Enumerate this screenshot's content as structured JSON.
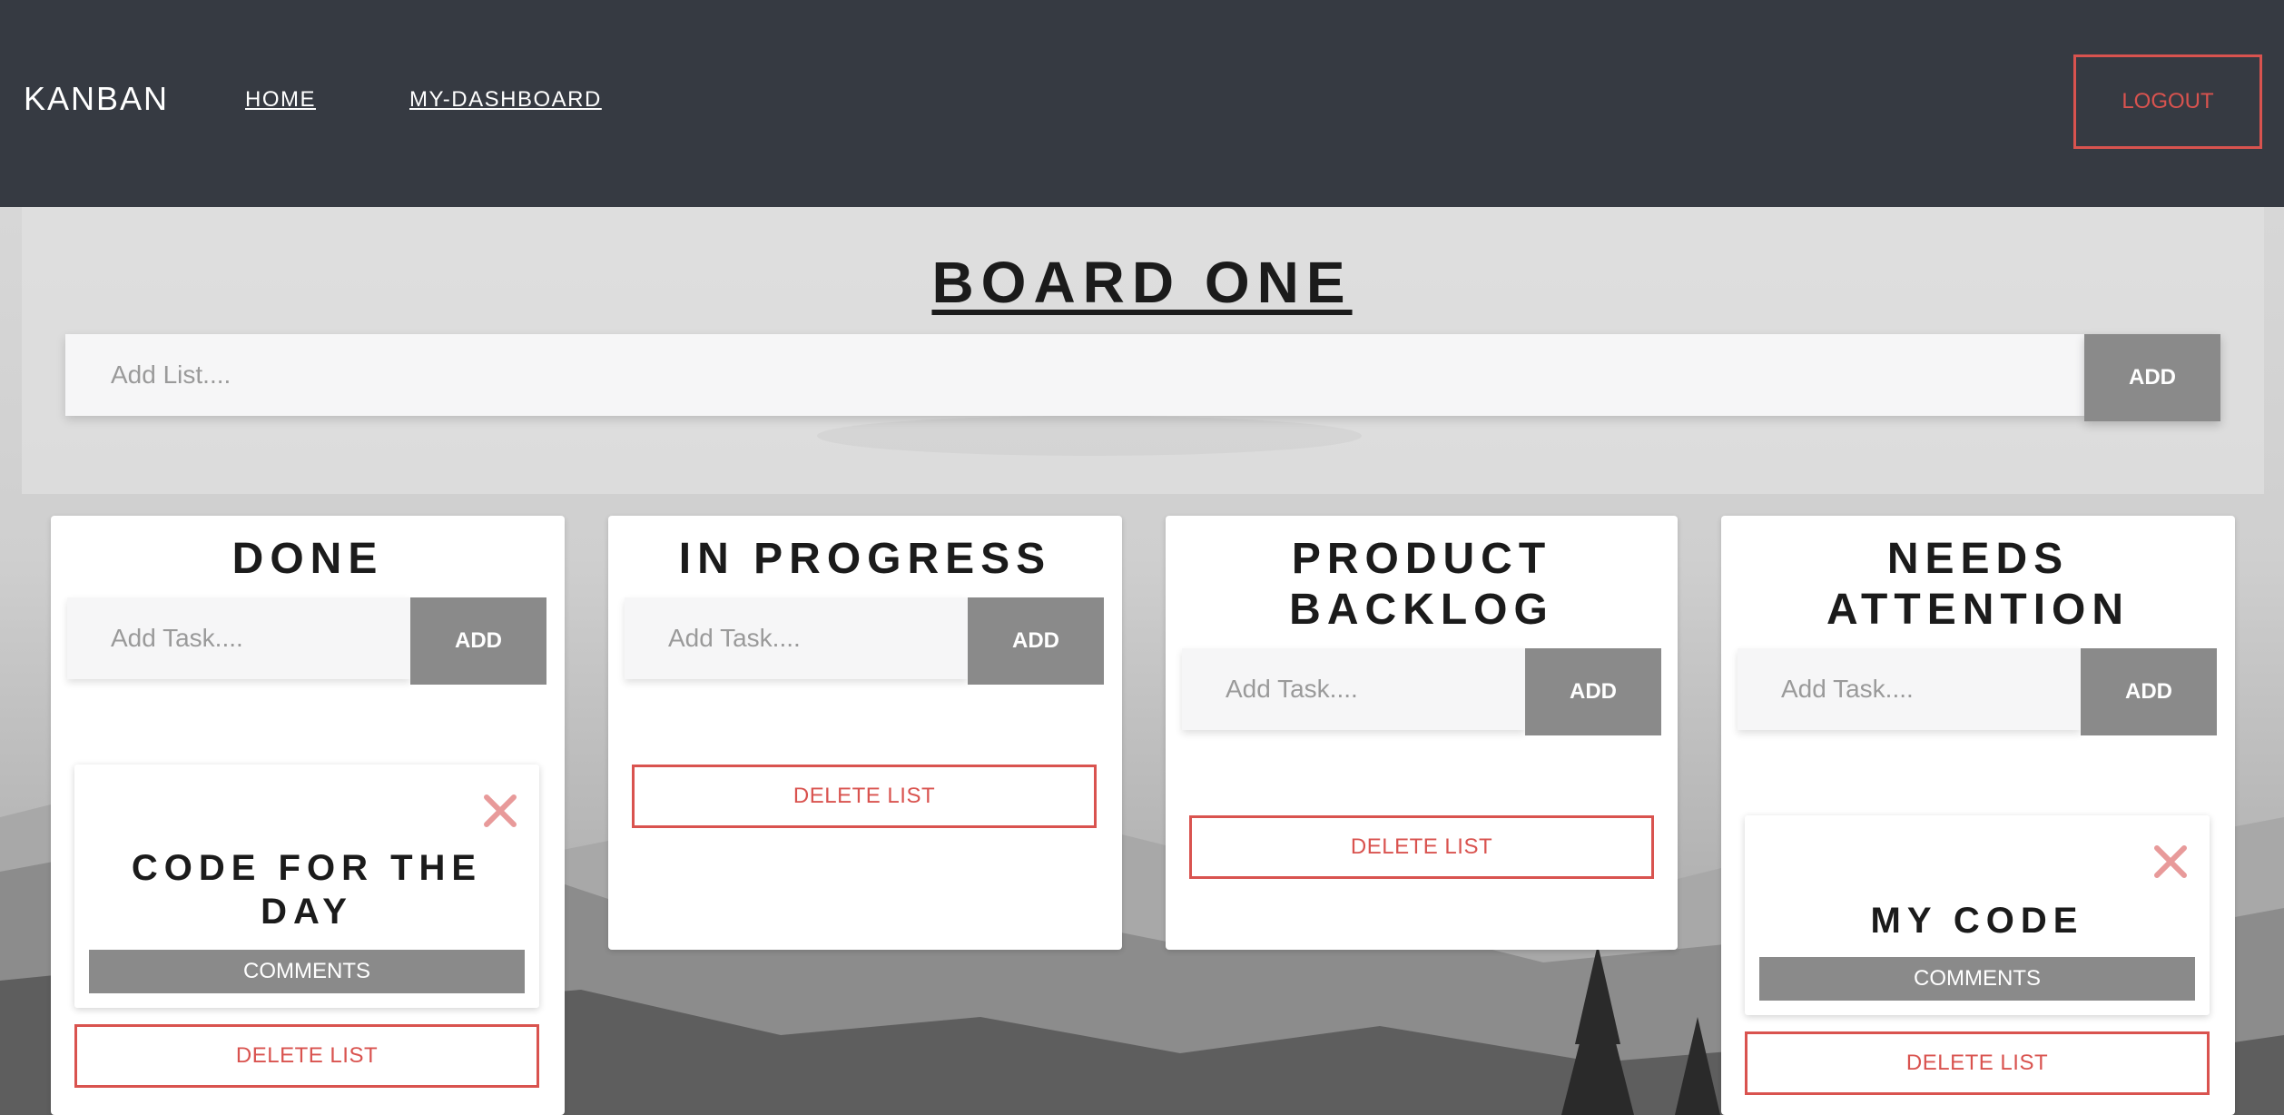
{
  "navbar": {
    "brand": "KANBAN",
    "links": [
      {
        "label": "HOME"
      },
      {
        "label": "MY-DASHBOARD"
      }
    ],
    "logout_label": "LOGOUT"
  },
  "board": {
    "title": "BOARD ONE",
    "add_list_placeholder": "Add List....",
    "add_list_button": "ADD"
  },
  "lists": [
    {
      "title_lines": [
        "DONE"
      ],
      "task_placeholder": "Add Task....",
      "add_label": "ADD",
      "tasks": [
        {
          "title_lines": [
            "CODE FOR THE",
            "DAY"
          ],
          "comments_label": "COMMENTS"
        }
      ],
      "delete_label": "DELETE LIST"
    },
    {
      "title_lines": [
        "IN PROGRESS"
      ],
      "task_placeholder": "Add Task....",
      "add_label": "ADD",
      "tasks": [],
      "delete_label": "DELETE LIST"
    },
    {
      "title_lines": [
        "PRODUCT",
        "BACKLOG"
      ],
      "task_placeholder": "Add Task....",
      "add_label": "ADD",
      "tasks": [],
      "delete_label": "DELETE LIST"
    },
    {
      "title_lines": [
        "NEEDS",
        "ATTENTION"
      ],
      "task_placeholder": "Add Task....",
      "add_label": "ADD",
      "tasks": [
        {
          "title_lines": [
            "MY CODE"
          ],
          "comments_label": "COMMENTS"
        }
      ],
      "delete_label": "DELETE LIST"
    }
  ],
  "colors": {
    "navbar": "#363a42",
    "accent_red": "#d9534f",
    "button_gray": "#8a8a8a",
    "close_icon": "#e89a9a"
  },
  "icons": {
    "task_close": "close-icon"
  }
}
